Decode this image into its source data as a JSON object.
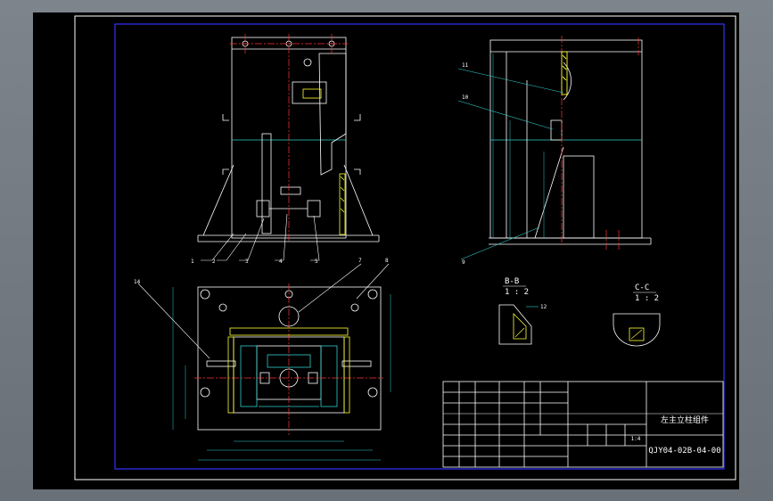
{
  "drawing": {
    "section_views": [
      {
        "label": "B-B",
        "scale": "1 : 2"
      },
      {
        "label": "C-C",
        "scale": "1 : 2"
      }
    ],
    "balloons": [
      "1",
      "2",
      "3",
      "4",
      "5",
      "7",
      "8",
      "9",
      "10",
      "11",
      "12",
      "14"
    ],
    "title_block": {
      "part_name": "左主立柱组件",
      "drawing_number": "QJY04-02B-04-00",
      "scale": "1:4"
    }
  }
}
